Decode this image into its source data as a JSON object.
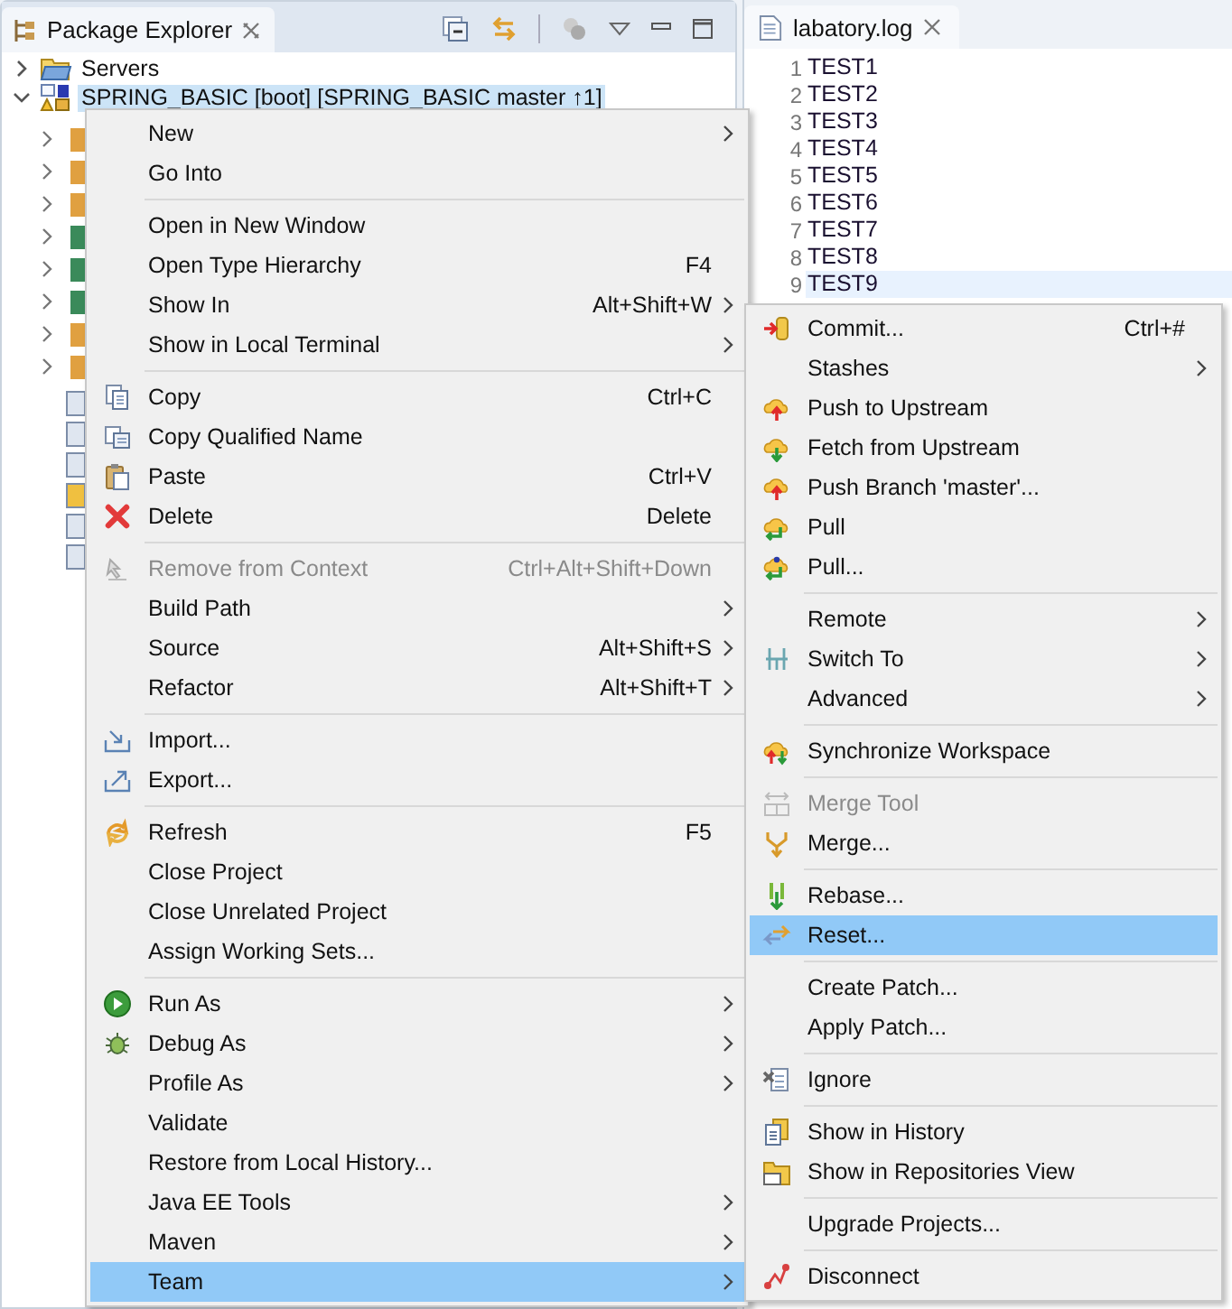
{
  "package_explorer": {
    "title": "Package Explorer",
    "tree": [
      {
        "label": "Servers",
        "expanded": false,
        "selected": false
      },
      {
        "label": "SPRING_BASIC [boot] [SPRING_BASIC master ↑1]",
        "expanded": true,
        "selected": true
      }
    ]
  },
  "editor": {
    "tab": {
      "label": "labatory.log"
    },
    "lines": [
      {
        "number": "1",
        "text": "TEST1",
        "current": false
      },
      {
        "number": "2",
        "text": "TEST2",
        "current": false
      },
      {
        "number": "3",
        "text": "TEST3",
        "current": false
      },
      {
        "number": "4",
        "text": "TEST4",
        "current": false
      },
      {
        "number": "5",
        "text": "TEST5",
        "current": false
      },
      {
        "number": "6",
        "text": "TEST6",
        "current": false
      },
      {
        "number": "7",
        "text": "TEST7",
        "current": false
      },
      {
        "number": "8",
        "text": "TEST8",
        "current": false
      },
      {
        "number": "9",
        "text": "TEST9",
        "current": true
      }
    ]
  },
  "context_menu": {
    "items": [
      {
        "kind": "item",
        "label": "New",
        "submenu": true,
        "disabled": false,
        "selected": false
      },
      {
        "kind": "item",
        "label": "Go Into",
        "submenu": false,
        "disabled": false,
        "selected": false
      },
      {
        "kind": "separator"
      },
      {
        "kind": "item",
        "label": "Open in New Window",
        "submenu": false,
        "disabled": false,
        "selected": false
      },
      {
        "kind": "item",
        "label": "Open Type Hierarchy",
        "shortcut": "F4",
        "submenu": false,
        "disabled": false,
        "selected": false
      },
      {
        "kind": "item",
        "label": "Show In",
        "shortcut": "Alt+Shift+W",
        "submenu": true,
        "disabled": false,
        "selected": false
      },
      {
        "kind": "item",
        "label": "Show in Local Terminal",
        "submenu": true,
        "disabled": false,
        "selected": false
      },
      {
        "kind": "separator"
      },
      {
        "kind": "item",
        "label": "Copy",
        "shortcut": "Ctrl+C",
        "submenu": false,
        "disabled": false,
        "selected": false
      },
      {
        "kind": "item",
        "label": "Copy Qualified Name",
        "submenu": false,
        "disabled": false,
        "selected": false
      },
      {
        "kind": "item",
        "label": "Paste",
        "shortcut": "Ctrl+V",
        "submenu": false,
        "disabled": false,
        "selected": false
      },
      {
        "kind": "item",
        "label": "Delete",
        "shortcut": "Delete",
        "submenu": false,
        "disabled": false,
        "selected": false
      },
      {
        "kind": "separator"
      },
      {
        "kind": "item",
        "label": "Remove from Context",
        "shortcut": "Ctrl+Alt+Shift+Down",
        "submenu": false,
        "disabled": true,
        "selected": false
      },
      {
        "kind": "item",
        "label": "Build Path",
        "submenu": true,
        "disabled": false,
        "selected": false
      },
      {
        "kind": "item",
        "label": "Source",
        "shortcut": "Alt+Shift+S",
        "submenu": true,
        "disabled": false,
        "selected": false
      },
      {
        "kind": "item",
        "label": "Refactor",
        "shortcut": "Alt+Shift+T",
        "submenu": true,
        "disabled": false,
        "selected": false
      },
      {
        "kind": "separator"
      },
      {
        "kind": "item",
        "label": "Import...",
        "submenu": false,
        "disabled": false,
        "selected": false
      },
      {
        "kind": "item",
        "label": "Export...",
        "submenu": false,
        "disabled": false,
        "selected": false
      },
      {
        "kind": "separator"
      },
      {
        "kind": "item",
        "label": "Refresh",
        "shortcut": "F5",
        "submenu": false,
        "disabled": false,
        "selected": false
      },
      {
        "kind": "item",
        "label": "Close Project",
        "submenu": false,
        "disabled": false,
        "selected": false
      },
      {
        "kind": "item",
        "label": "Close Unrelated Project",
        "submenu": false,
        "disabled": false,
        "selected": false
      },
      {
        "kind": "item",
        "label": "Assign Working Sets...",
        "submenu": false,
        "disabled": false,
        "selected": false
      },
      {
        "kind": "separator"
      },
      {
        "kind": "item",
        "label": "Run As",
        "submenu": true,
        "disabled": false,
        "selected": false
      },
      {
        "kind": "item",
        "label": "Debug As",
        "submenu": true,
        "disabled": false,
        "selected": false
      },
      {
        "kind": "item",
        "label": "Profile As",
        "submenu": true,
        "disabled": false,
        "selected": false
      },
      {
        "kind": "item",
        "label": "Validate",
        "submenu": false,
        "disabled": false,
        "selected": false
      },
      {
        "kind": "item",
        "label": "Restore from Local History...",
        "submenu": false,
        "disabled": false,
        "selected": false
      },
      {
        "kind": "item",
        "label": "Java EE Tools",
        "submenu": true,
        "disabled": false,
        "selected": false
      },
      {
        "kind": "item",
        "label": "Maven",
        "submenu": true,
        "disabled": false,
        "selected": false
      },
      {
        "kind": "item",
        "label": "Team",
        "submenu": true,
        "disabled": false,
        "selected": true
      }
    ]
  },
  "team_submenu": {
    "items": [
      {
        "kind": "item",
        "label": "Commit...",
        "shortcut": "Ctrl+#",
        "submenu": false,
        "disabled": false,
        "selected": false
      },
      {
        "kind": "item",
        "label": "Stashes",
        "submenu": true,
        "disabled": false,
        "selected": false
      },
      {
        "kind": "item",
        "label": "Push to Upstream",
        "submenu": false,
        "disabled": false,
        "selected": false
      },
      {
        "kind": "item",
        "label": "Fetch from Upstream",
        "submenu": false,
        "disabled": false,
        "selected": false
      },
      {
        "kind": "item",
        "label": "Push Branch 'master'...",
        "submenu": false,
        "disabled": false,
        "selected": false
      },
      {
        "kind": "item",
        "label": "Pull",
        "submenu": false,
        "disabled": false,
        "selected": false
      },
      {
        "kind": "item",
        "label": "Pull...",
        "submenu": false,
        "disabled": false,
        "selected": false
      },
      {
        "kind": "separator"
      },
      {
        "kind": "item",
        "label": "Remote",
        "submenu": true,
        "disabled": false,
        "selected": false
      },
      {
        "kind": "item",
        "label": "Switch To",
        "submenu": true,
        "disabled": false,
        "selected": false
      },
      {
        "kind": "item",
        "label": "Advanced",
        "submenu": true,
        "disabled": false,
        "selected": false
      },
      {
        "kind": "separator"
      },
      {
        "kind": "item",
        "label": "Synchronize Workspace",
        "submenu": false,
        "disabled": false,
        "selected": false
      },
      {
        "kind": "separator"
      },
      {
        "kind": "item",
        "label": "Merge Tool",
        "submenu": false,
        "disabled": true,
        "selected": false
      },
      {
        "kind": "item",
        "label": "Merge...",
        "submenu": false,
        "disabled": false,
        "selected": false
      },
      {
        "kind": "separator"
      },
      {
        "kind": "item",
        "label": "Rebase...",
        "submenu": false,
        "disabled": false,
        "selected": false
      },
      {
        "kind": "item",
        "label": "Reset...",
        "submenu": false,
        "disabled": false,
        "selected": true
      },
      {
        "kind": "separator"
      },
      {
        "kind": "item",
        "label": "Create Patch...",
        "submenu": false,
        "disabled": false,
        "selected": false
      },
      {
        "kind": "item",
        "label": "Apply Patch...",
        "submenu": false,
        "disabled": false,
        "selected": false
      },
      {
        "kind": "separator"
      },
      {
        "kind": "item",
        "label": "Ignore",
        "submenu": false,
        "disabled": false,
        "selected": false
      },
      {
        "kind": "separator"
      },
      {
        "kind": "item",
        "label": "Show in History",
        "submenu": false,
        "disabled": false,
        "selected": false
      },
      {
        "kind": "item",
        "label": "Show in Repositories View",
        "submenu": false,
        "disabled": false,
        "selected": false
      },
      {
        "kind": "separator"
      },
      {
        "kind": "item",
        "label": "Upgrade Projects...",
        "submenu": false,
        "disabled": false,
        "selected": false
      },
      {
        "kind": "separator"
      },
      {
        "kind": "item",
        "label": "Disconnect",
        "submenu": false,
        "disabled": false,
        "selected": false
      }
    ]
  }
}
